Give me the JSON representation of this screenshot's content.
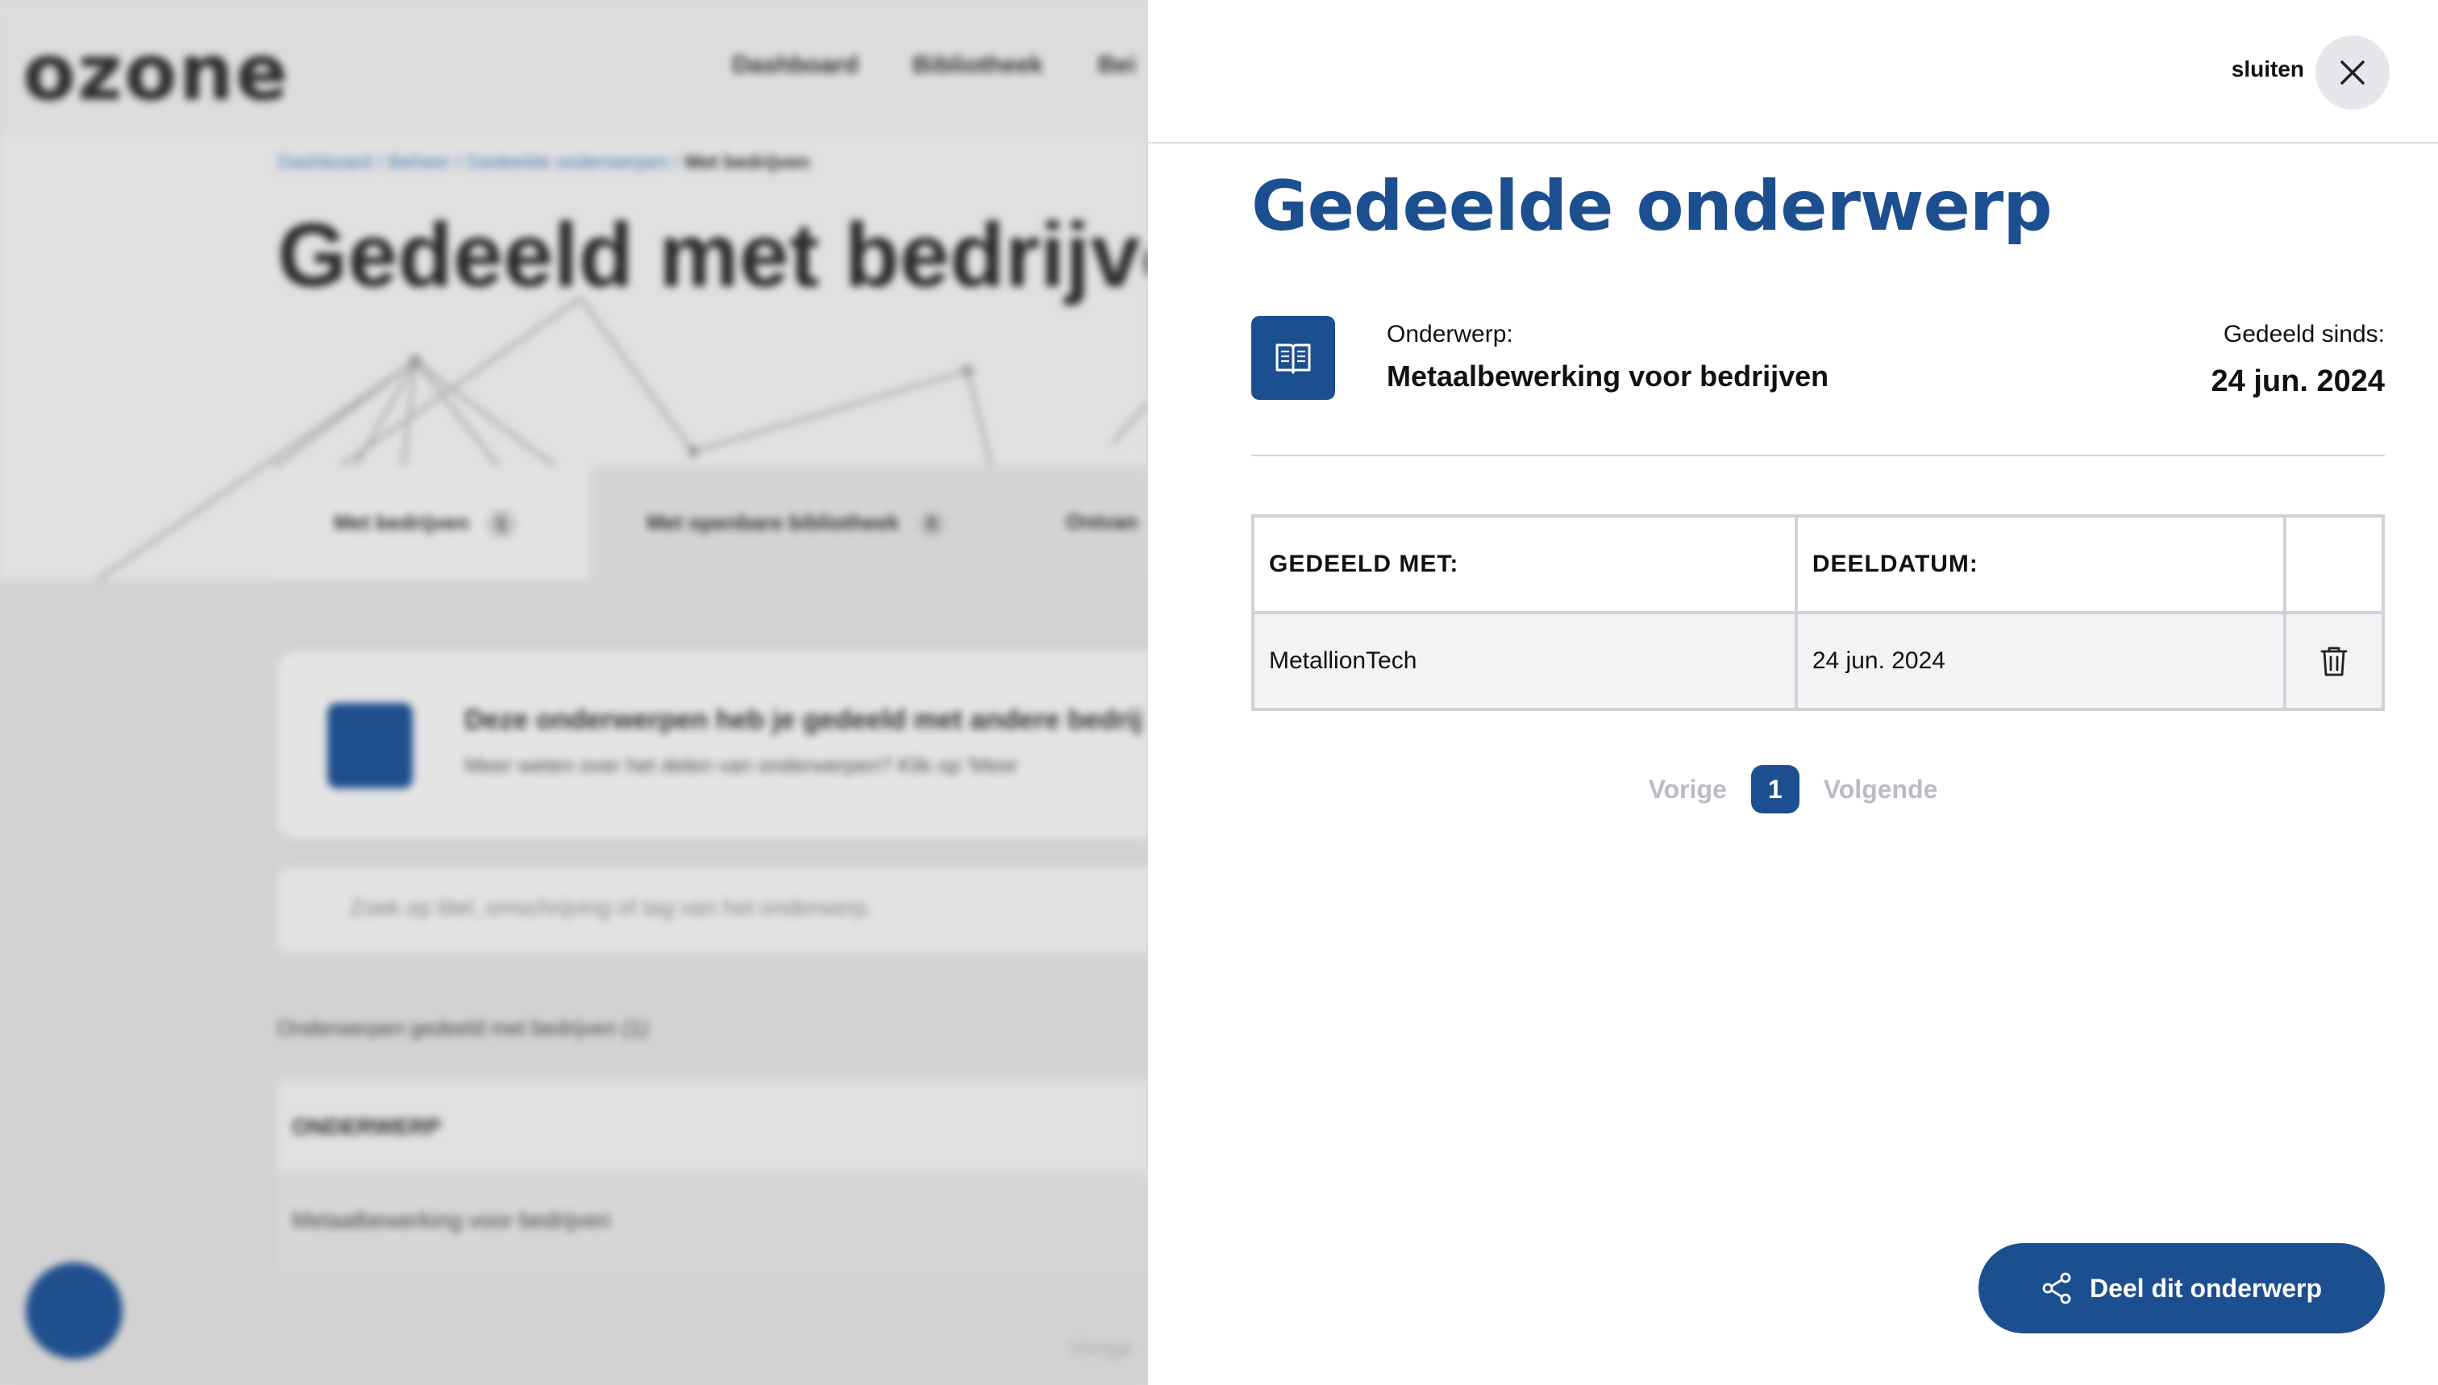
{
  "background_page": {
    "logo": "ozone",
    "nav": [
      "Dashboard",
      "Bibliotheek",
      "Bei"
    ],
    "breadcrumb": [
      "Dashboard",
      "Beheer",
      "Gedeelde onderwerpen",
      "Met bedrijven"
    ],
    "title": "Gedeeld met bedrijve",
    "tabs": [
      {
        "label": "Met bedrijven",
        "count": "1"
      },
      {
        "label": "Met openbare bibliotheek",
        "count": "0"
      },
      {
        "label": "Ontvan"
      }
    ],
    "info_title": "Deze onderwerpen heb je gedeeld met andere bedrij",
    "info_sub": "Meer weten over het delen van onderwerpen? Klik op 'Meer",
    "search_placeholder": "Zoek op titel, omschrijving of tag van het onderwerp.",
    "list_label": "Onderwerpen gedeeld met bedrijven (1)",
    "table_header": "ONDERWERP",
    "table_row": "Metaalbewerking voor bedrijven",
    "pager_prev": "Vorige"
  },
  "drawer": {
    "close_label": "sluiten",
    "title": "Gedeelde onderwerp",
    "subject_label": "Onderwerp:",
    "subject_value": "Metaalbewerking voor bedrijven",
    "since_label": "Gedeeld sinds:",
    "since_value": "24 jun. 2024",
    "table": {
      "headers": [
        "GEDEELD MET:",
        "DEELDATUM:",
        ""
      ],
      "rows": [
        {
          "company": "MetallionTech",
          "date": "24 jun. 2024"
        }
      ]
    },
    "pagination": {
      "prev": "Vorige",
      "current": "1",
      "next": "Volgende"
    },
    "share_button": "Deel dit onderwerp"
  },
  "colors": {
    "brand": "#1c4f8f",
    "muted": "#b9bdc3",
    "row_bg": "#f2f3f5"
  },
  "icons": [
    "close-icon",
    "book-icon",
    "trash-icon",
    "share-icon"
  ]
}
